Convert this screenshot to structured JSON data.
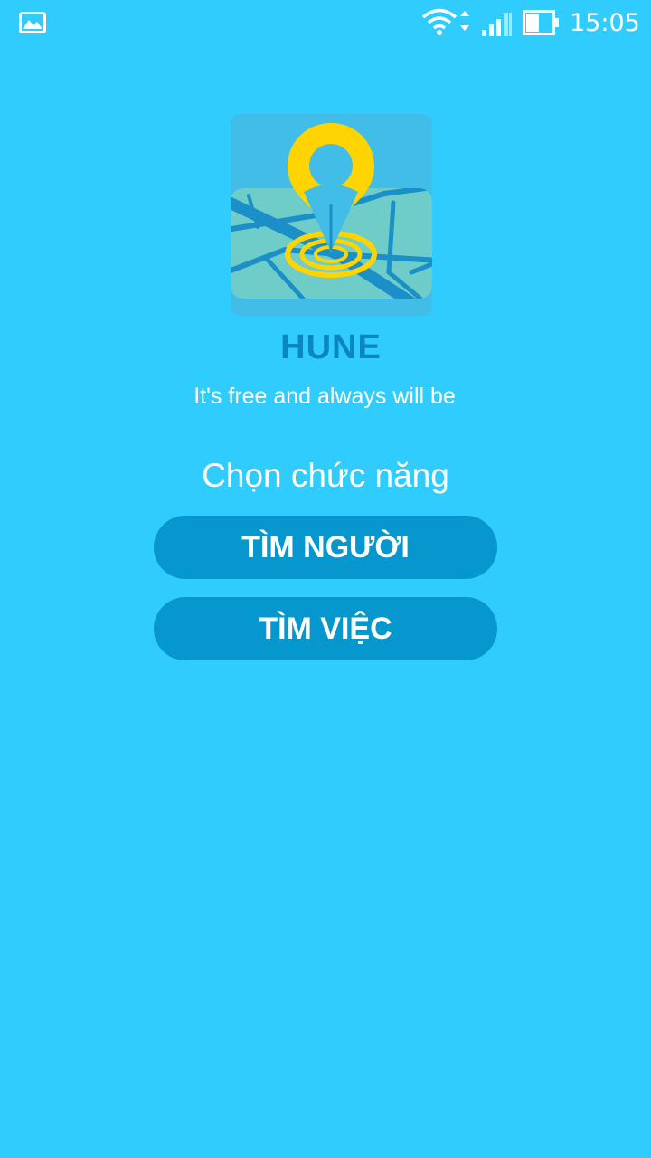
{
  "status_bar": {
    "time": "15:05",
    "icons": [
      "gallery-notification-icon",
      "wifi-icon",
      "signal-icon",
      "battery-icon"
    ]
  },
  "app": {
    "name": "HUNE",
    "tagline": "It's free and always will be",
    "logo_icon": "map-pin-logo-icon"
  },
  "main": {
    "heading": "Chọn chức năng",
    "buttons": {
      "find_people": "TÌM NGƯỜI",
      "find_jobs": "TÌM VIỆC"
    }
  },
  "colors": {
    "background": "#31ccfe",
    "button": "#0597cd",
    "app_name": "#0a86c0",
    "pin": "#ffd400"
  }
}
